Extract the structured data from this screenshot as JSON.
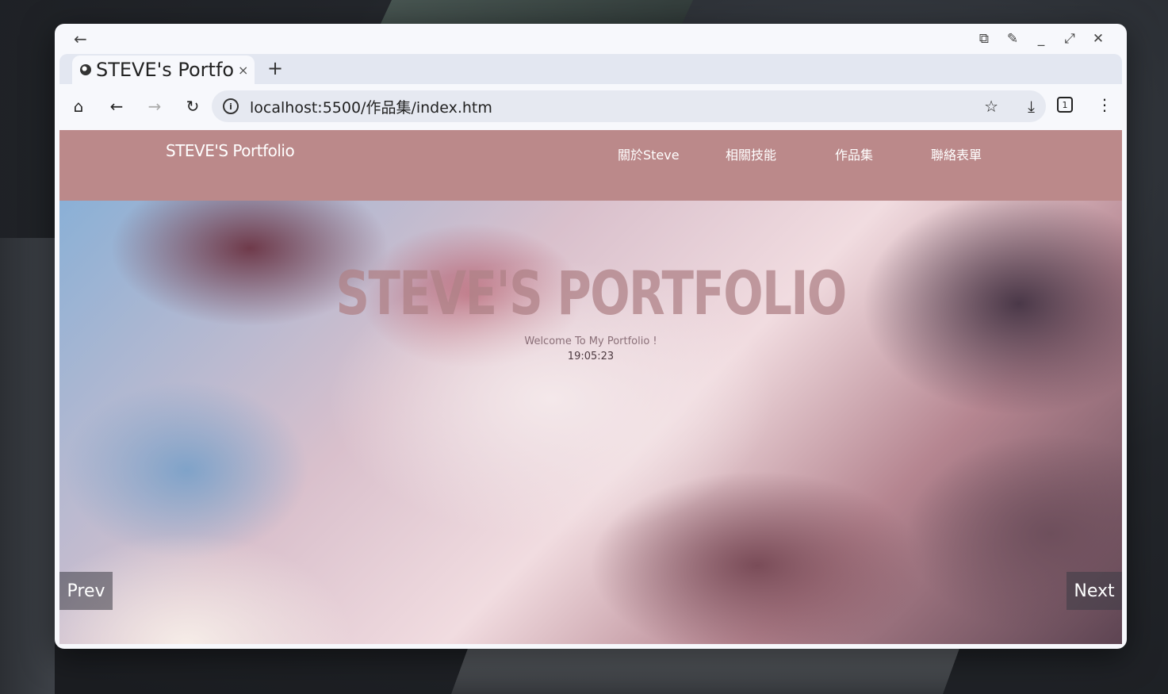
{
  "browser": {
    "tab": {
      "title": "STEVE's Portfo",
      "close": "×"
    },
    "new_tab": "+",
    "url": "localhost:5500/作品集/index.htm",
    "tabs_count": "1"
  },
  "site": {
    "logo": "STEVE'S Portfolio",
    "menu": [
      "關於Steve",
      "相關技能",
      "作品集",
      "聯絡表單"
    ],
    "hero": {
      "title": "STEVE'S PORTFOLIO",
      "subtitle": "Welcome To My Portfolio !",
      "clock": "19:05:23"
    },
    "carousel": {
      "prev": "Prev",
      "next": "Next"
    }
  }
}
